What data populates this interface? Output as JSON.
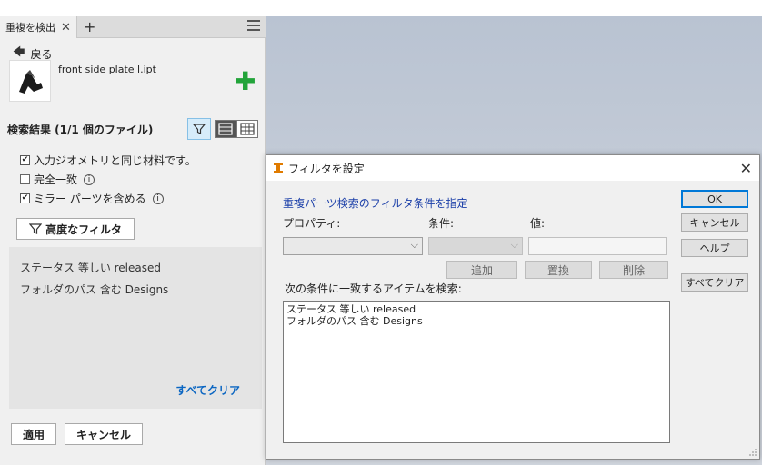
{
  "panel": {
    "tab_label": "重複を検出",
    "back_label": "戻る",
    "file_name": "front side plate l.ipt",
    "results_title": "検索結果 (1/1 個のファイル)",
    "checks": [
      {
        "label": "入力ジオメトリと同じ材料です。",
        "checked": true,
        "info": false
      },
      {
        "label": "完全一致",
        "checked": false,
        "info": true
      },
      {
        "label": "ミラー パーツを含める",
        "checked": true,
        "info": true
      }
    ],
    "advanced_filter_label": "高度なフィルタ",
    "conditions": [
      "ステータス 等しい released",
      "フォルダのパス 含む Designs"
    ],
    "clear_all_label": "すべてクリア",
    "apply_label": "適用",
    "cancel_label": "キャンセル"
  },
  "dialog": {
    "title": "フィルタを設定",
    "heading": "重複パーツ検索のフィルタ条件を指定",
    "property_label": "プロパティ:",
    "condition_label": "条件:",
    "value_label": "値:",
    "add_label": "追加",
    "replace_label": "置換",
    "delete_label": "削除",
    "match_label": "次の条件に一致するアイテムを検索:",
    "conditions": [
      "ステータス 等しい released",
      "フォルダのパス 含む Designs"
    ],
    "ok_label": "OK",
    "cancel_label": "キャンセル",
    "help_label": "ヘルプ",
    "clear_all_label": "すべてクリア"
  },
  "colors": {
    "accent_blue": "#0b66c2",
    "green_plus": "#22a43a",
    "dialog_heading": "#1a3ea8"
  }
}
